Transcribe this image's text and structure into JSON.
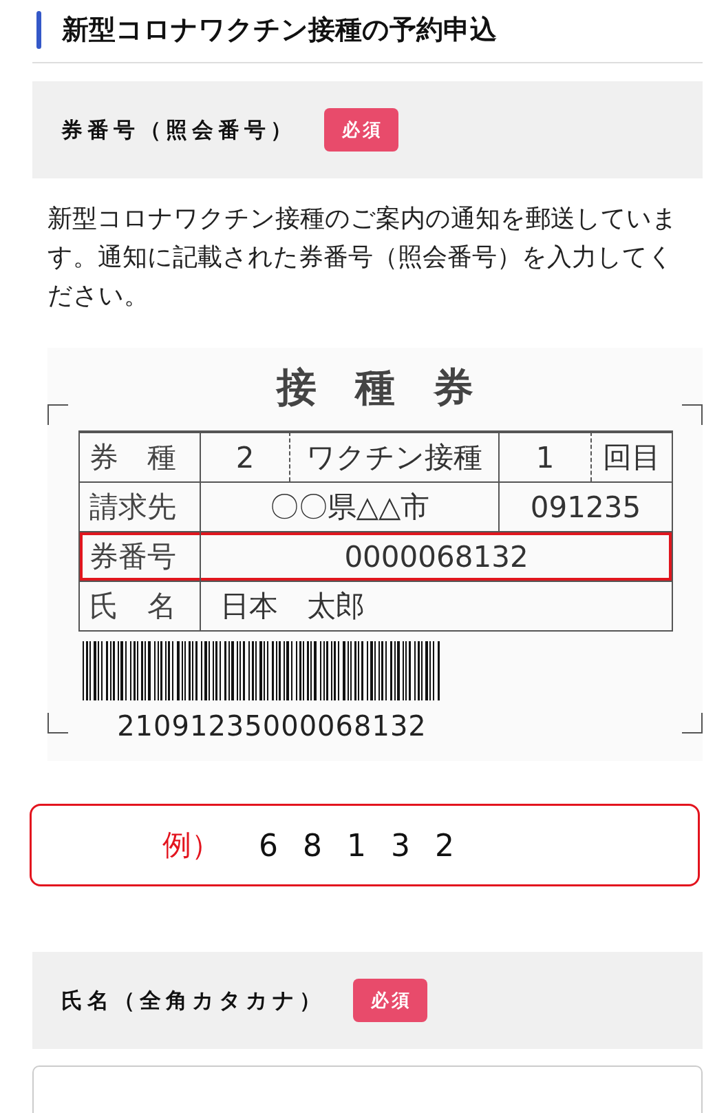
{
  "header": {
    "title": "新型コロナワクチン接種の予約申込"
  },
  "ticket_section": {
    "label": "券番号（照会番号）",
    "badge": "必須",
    "description": "新型コロナワクチン接種のご案内の通知を郵送しています。通知に記載された券番号（照会番号）を入力してください。",
    "sample_ticket": {
      "title": "接種券",
      "lines": [
        {
          "kind": "split4",
          "label": "券　種",
          "highlighted": false,
          "fields": [
            "2",
            "ワクチン接種",
            "1",
            "回目"
          ]
        },
        {
          "kind": "split2",
          "label": "請求先",
          "highlighted": false,
          "fields": [
            "〇〇県△△市",
            "091235"
          ]
        },
        {
          "kind": "full",
          "label": "券番号",
          "highlighted": true,
          "fields": [
            "0000068132"
          ]
        },
        {
          "kind": "name",
          "label": "氏　名",
          "highlighted": false,
          "fields": [
            "日本　太郎"
          ]
        }
      ],
      "barcode_number": "21091235000068132"
    },
    "example": {
      "prefix": "例）",
      "value": "6 8 1 3 2"
    }
  },
  "name_section": {
    "label": "氏名（全角カタカナ）",
    "badge": "必須"
  }
}
